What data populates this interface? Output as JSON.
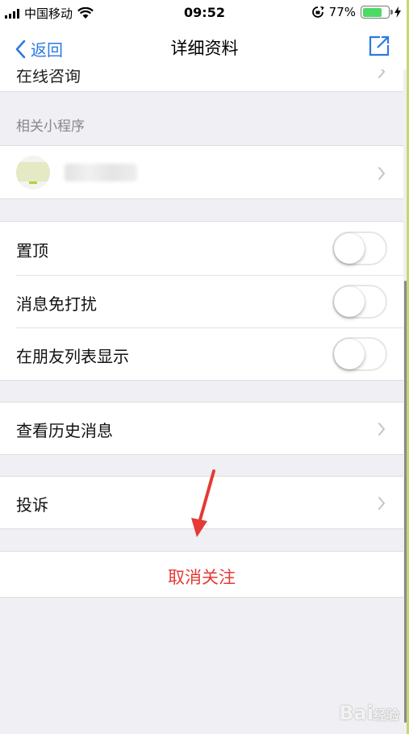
{
  "status_bar": {
    "carrier": "中国移动",
    "time": "09:52",
    "battery_percent": "77%",
    "battery_level": 0.77,
    "battery_color": "#4cd964"
  },
  "nav": {
    "back_label": "返回",
    "title": "详细资料",
    "share_icon": "share-external-icon"
  },
  "partial_row_label": "在线咨询",
  "mini_programs": {
    "header": "相关小程序"
  },
  "settings": {
    "toggles": [
      {
        "label": "置顶",
        "on": false
      },
      {
        "label": "消息免打扰",
        "on": false
      },
      {
        "label": "在朋友列表显示",
        "on": false
      }
    ]
  },
  "history": {
    "label": "查看历史消息"
  },
  "complain": {
    "label": "投诉"
  },
  "unfollow": {
    "label": "取消关注"
  },
  "watermark": {
    "text": "Bai",
    "sub": "经验"
  },
  "colors": {
    "accent": "#2c7ae0",
    "danger": "#e53a35",
    "background": "#efeff4"
  }
}
